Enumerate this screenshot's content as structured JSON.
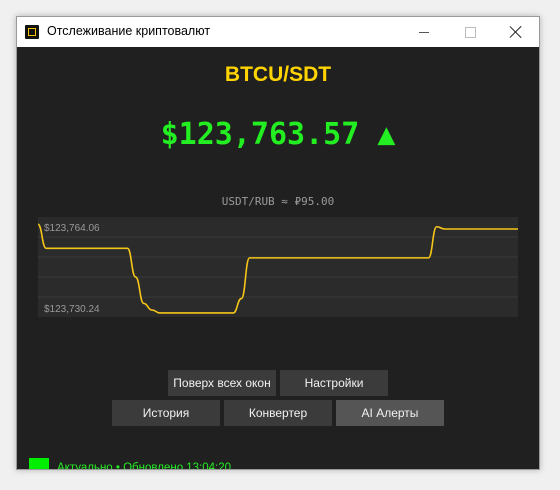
{
  "window": {
    "title": "Отслеживание криптовалют",
    "icons": {
      "app": "app-icon",
      "minimize": "minimize-icon",
      "maximize": "maximize-icon",
      "close": "close-icon"
    }
  },
  "ticker": {
    "pair": "BTCU/SDT",
    "price": "$123,763.57",
    "trend_arrow": "▲",
    "rate": "USDT/RUB ≈ ₽95.00"
  },
  "chart_data": {
    "type": "line",
    "title": "",
    "xlabel": "",
    "ylabel": "",
    "y_tick_labels": [
      "$123,764.06",
      "$123,730.24"
    ],
    "grid": true,
    "ylim": [
      123730.24,
      123764.06
    ],
    "series": [
      {
        "color": "#f5c518",
        "values": [
          123766,
          123756,
          123756,
          123756,
          123756,
          123756,
          123756,
          123756,
          123756,
          123756,
          123756,
          123756,
          123744,
          123733,
          123730.24,
          123729,
          123729,
          123729,
          123729,
          123729,
          123729,
          123729,
          123729,
          123729,
          123729,
          123735,
          123752,
          123752,
          123752,
          123752,
          123752,
          123752,
          123752,
          123752,
          123752,
          123752,
          123752,
          123752,
          123752,
          123752,
          123752,
          123752,
          123752,
          123752,
          123752,
          123752,
          123752,
          123752,
          123752,
          123765,
          123764.06,
          123764.06,
          123764.06,
          123764.06,
          123764.06,
          123764.06,
          123764.06,
          123764.06,
          123764.06,
          123764.06
        ]
      }
    ]
  },
  "buttons": {
    "on_top": "Поверх всех окон",
    "settings": "Настройки",
    "history": "История",
    "converter": "Конвертер",
    "ai_alerts": "AI Алерты"
  },
  "status": {
    "text": "Актуально • Обновлено 13:04:20",
    "indicator_color": "#00ee00"
  }
}
